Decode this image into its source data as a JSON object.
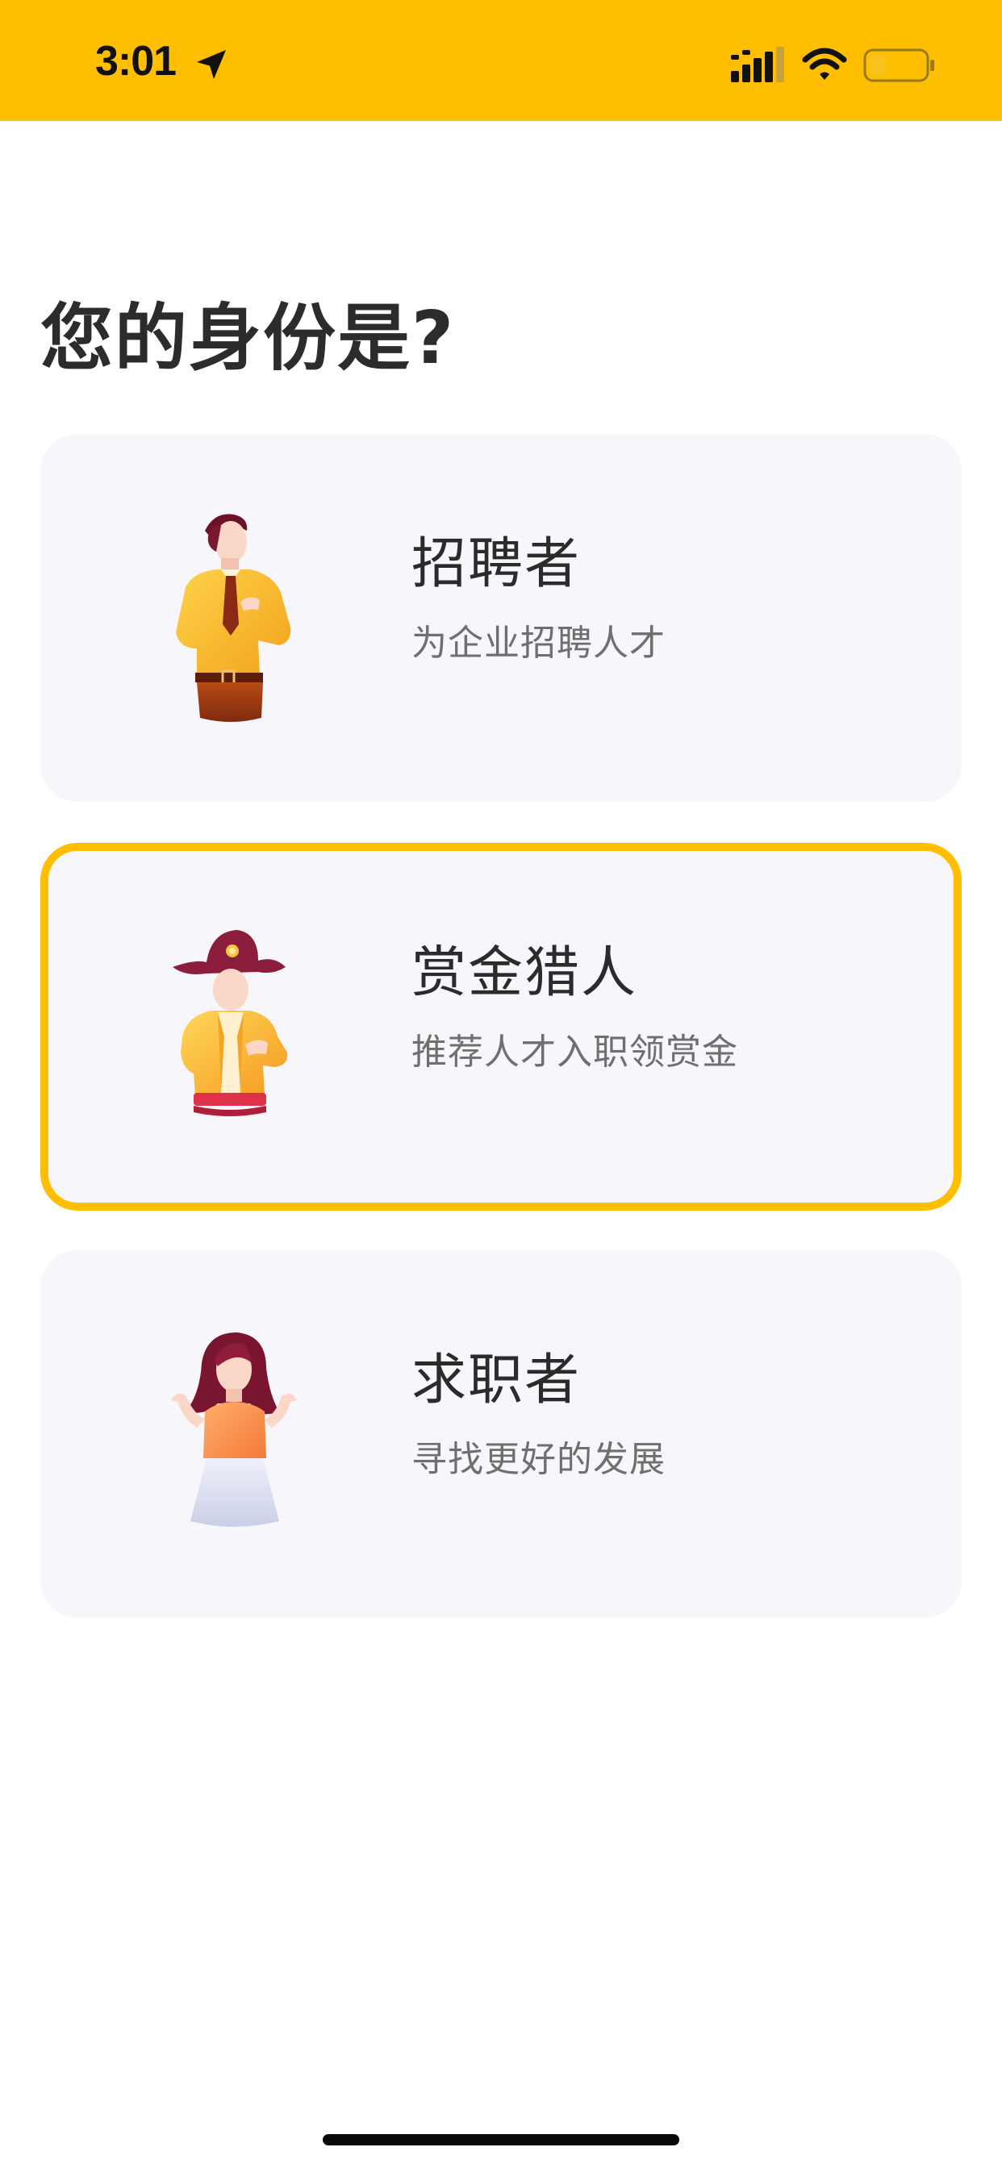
{
  "status_bar": {
    "time": "3:01",
    "icons": [
      "location-arrow-icon",
      "cellular-signal-icon",
      "wifi-icon",
      "battery-icon"
    ],
    "background_color": "#FFBF00"
  },
  "title": "您的身份是?",
  "roles": [
    {
      "name": "招聘者",
      "description": "为企业招聘人才",
      "illustration": "recruiter-illustration",
      "selected": false
    },
    {
      "name": "赏金猎人",
      "description": "推荐人才入职领赏金",
      "illustration": "bounty-hunter-illustration",
      "selected": true
    },
    {
      "name": "求职者",
      "description": "寻找更好的发展",
      "illustration": "job-seeker-illustration",
      "selected": false
    }
  ],
  "colors": {
    "accent": "#FFBF00",
    "card_background": "#F7F6FB",
    "title_text": "#2c2c2c",
    "secondary_text": "#6f6f6f"
  }
}
